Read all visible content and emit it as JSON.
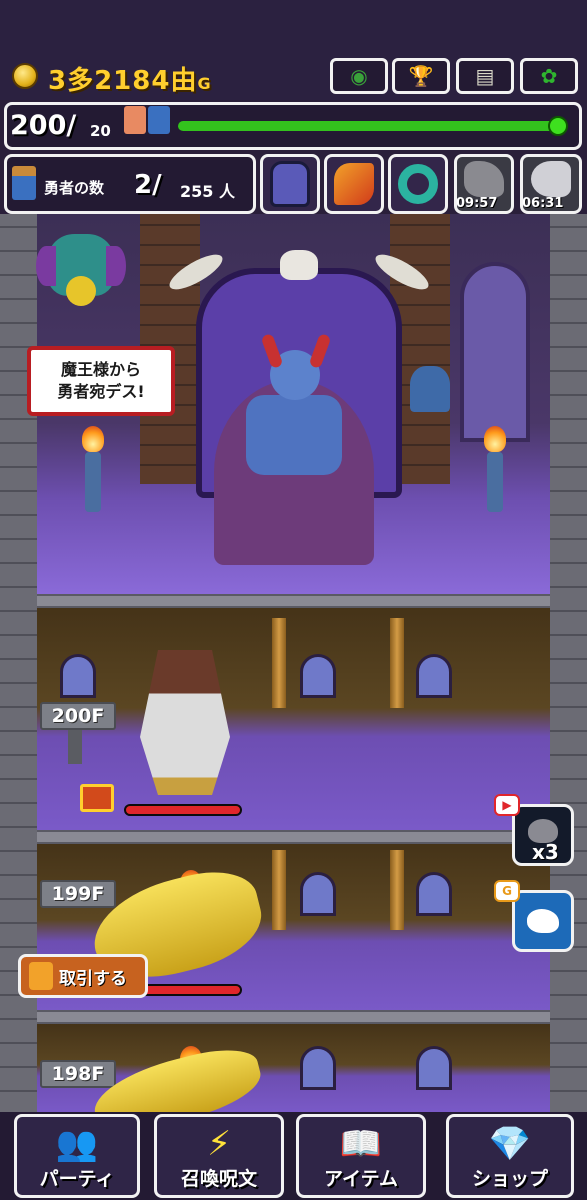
{
  "header": {
    "gold_main": "3多2184由",
    "gold_unit": "G",
    "buttons": [
      {
        "name": "map-button",
        "icon": "orb-icon",
        "glyph": "◉"
      },
      {
        "name": "trophy-button",
        "icon": "trophy-icon",
        "glyph": "🏆"
      },
      {
        "name": "log-button",
        "icon": "document-icon",
        "glyph": "▤"
      },
      {
        "name": "settings-button",
        "icon": "gear-icon",
        "glyph": "✿"
      }
    ]
  },
  "tower_hp": {
    "current": "200",
    "slash": "/",
    "max": "20",
    "fill_fraction": 1.0
  },
  "heroes": {
    "label": "勇者の数",
    "count": "2",
    "slash": "/",
    "total": "255",
    "unit": "人"
  },
  "summons": [
    {
      "name": "knight-summon-slot",
      "icon": "helmet-icon",
      "timer": ""
    },
    {
      "name": "dragon-summon-slot",
      "icon": "dragon-icon",
      "timer": ""
    },
    {
      "name": "serpent-summon-slot",
      "icon": "serpent-icon",
      "timer": ""
    },
    {
      "name": "wolf-summon-slot",
      "icon": "wolf-icon",
      "timer": "09:57"
    },
    {
      "name": "eagle-summon-slot",
      "icon": "eagle-icon",
      "timer": "06:31"
    }
  ],
  "throne_room": {
    "speech_line1": "魔王様から",
    "speech_line2": "勇者宛デス!"
  },
  "floors": [
    {
      "label": "200F",
      "enemy_hp_fraction": 1.0
    },
    {
      "label": "199F",
      "enemy_hp_fraction": 1.0
    },
    {
      "label": "198F"
    }
  ],
  "side_buttons": {
    "rock_multiplier": "x3",
    "video_badge": "▶",
    "twitter_badge": "G"
  },
  "trade_button": {
    "label": "取引する"
  },
  "nav": [
    {
      "label": "パーティ",
      "icon": "party-icon",
      "glyph": "👥"
    },
    {
      "label": "召喚呪文",
      "icon": "lightning-icon",
      "glyph": "⚡"
    },
    {
      "label": "アイテム",
      "icon": "book-icon",
      "glyph": "📖"
    },
    {
      "label": "ショップ",
      "icon": "diamond-icon",
      "glyph": "💎"
    }
  ],
  "colors": {
    "gold": "#ffcf2e",
    "hp_green": "#33c21d",
    "enemy_red": "#e0262b",
    "accent_red": "#b81d22"
  }
}
